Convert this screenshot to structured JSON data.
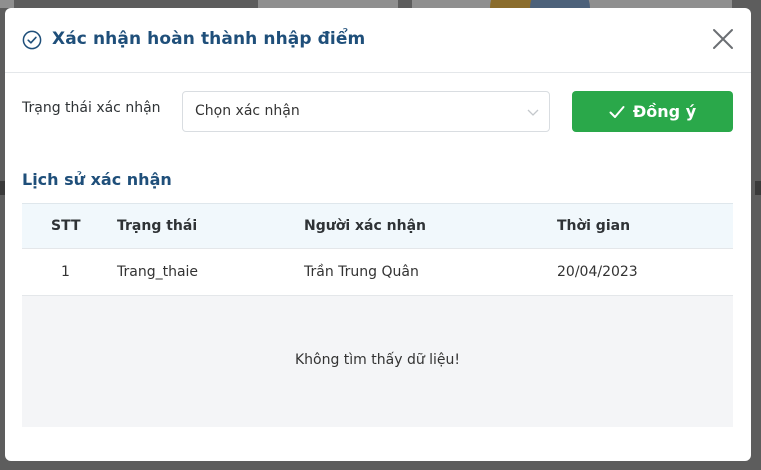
{
  "modal": {
    "title": "Xác nhận hoàn thành nhập điểm",
    "title_icon": "check-circle-icon",
    "close_icon": "close-icon"
  },
  "form": {
    "status_label": "Trạng thái xác nhận",
    "select_value": "Chọn xác nhận",
    "select_icon": "chevron-down-icon",
    "agree_label": "Đồng ý",
    "agree_icon": "check-icon"
  },
  "history": {
    "title": "Lịch sử xác nhận",
    "columns": [
      "STT",
      "Trạng thái",
      "Người xác nhận",
      "Thời gian"
    ],
    "rows": [
      {
        "stt": "1",
        "status": "Trang_thaie",
        "confirmer": "Trần Trung Quân",
        "time": "20/04/2023"
      }
    ],
    "empty_text": "Không tìm thấy dữ liệu!"
  },
  "colors": {
    "title": "#1f4f7a",
    "primary_button": "#2aa84a",
    "table_header_bg": "#f1f8fc",
    "empty_bg": "#f4f5f7"
  }
}
